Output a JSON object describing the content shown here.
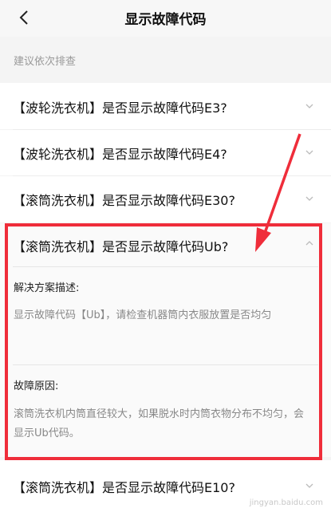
{
  "header": {
    "title": "显示故障代码",
    "back_icon": "chevron-left-icon"
  },
  "section_label": "建议依次排查",
  "items": [
    {
      "title": "【波轮洗衣机】是否显示故障代码E3?",
      "expanded": false
    },
    {
      "title": "【波轮洗衣机】是否显示故障代码E4?",
      "expanded": false
    },
    {
      "title": "【滚筒洗衣机】是否显示故障代码E30?",
      "expanded": false
    },
    {
      "title": "【滚筒洗衣机】是否显示故障代码Ub?",
      "expanded": true
    },
    {
      "title": "【滚筒洗衣机】是否显示故障代码E10?",
      "expanded": false
    }
  ],
  "expanded_detail": {
    "solution_heading": "解决方案描述:",
    "solution_text": "显示故障代码【Ub】，请检查机器筒内衣服放置是否均匀",
    "cause_heading": "故障原因:",
    "cause_text": "滚筒洗衣机内筒直径较大，如果脱水时内筒衣物分布不均匀，会显示Ub代码。"
  },
  "annotation": {
    "highlight_color": "#ef2d3a"
  },
  "watermark": "jingyan.baidu.com"
}
